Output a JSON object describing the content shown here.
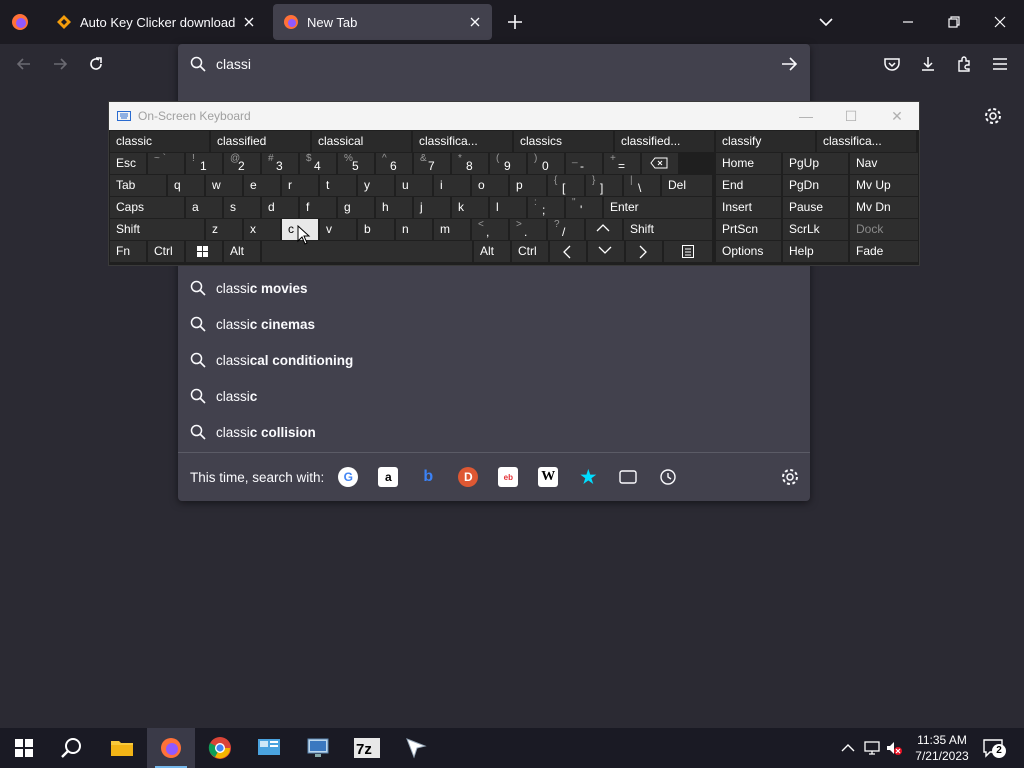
{
  "tabs": [
    {
      "title": "Auto Key Clicker download | So"
    },
    {
      "title": "New Tab"
    }
  ],
  "url": {
    "value": "classi"
  },
  "suggestions": [
    {
      "typed": "classi",
      "rest": "c movies"
    },
    {
      "typed": "classi",
      "rest": "c cinemas"
    },
    {
      "typed": "classi",
      "rest": "cal conditioning"
    },
    {
      "typed": "classi",
      "rest": "c"
    },
    {
      "typed": "classi",
      "rest": "c collision"
    }
  ],
  "oneoff": {
    "label": "This time, search with:"
  },
  "osk": {
    "title": "On-Screen Keyboard",
    "predictions": [
      "classic",
      "classified",
      "classical",
      "classifica...",
      "classics",
      "classified...",
      "classify",
      "classifica..."
    ],
    "keys": {
      "esc": "Esc",
      "tab": "Tab",
      "caps": "Caps",
      "shift": "Shift",
      "fn": "Fn",
      "ctrl": "Ctrl",
      "alt": "Alt",
      "del": "Del",
      "enter": "Enter",
      "shift_r": "Shift",
      "alt_r": "Alt",
      "ctrl_r": "Ctrl",
      "row1": [
        [
          "~ `",
          ""
        ],
        [
          "!",
          "1"
        ],
        [
          "@",
          "2"
        ],
        [
          "#",
          "3"
        ],
        [
          "$",
          "4"
        ],
        [
          "%",
          "5"
        ],
        [
          "^",
          "6"
        ],
        [
          "&",
          "7"
        ],
        [
          "*",
          "8"
        ],
        [
          "(",
          "9"
        ],
        [
          ")",
          "0"
        ],
        [
          "_",
          "-"
        ],
        [
          "+",
          "="
        ]
      ],
      "row2": [
        "q",
        "w",
        "e",
        "r",
        "t",
        "y",
        "u",
        "i",
        "o",
        "p"
      ],
      "row2b": [
        [
          "{",
          "["
        ],
        [
          "}",
          "]"
        ],
        [
          "|",
          "\\"
        ]
      ],
      "row3": [
        "a",
        "s",
        "d",
        "f",
        "g",
        "h",
        "j",
        "k",
        "l"
      ],
      "row3b": [
        [
          ":",
          ";"
        ],
        [
          "\"",
          "'"
        ]
      ],
      "row4": [
        "z",
        "x",
        "c",
        "v",
        "b",
        "n",
        "m"
      ],
      "row4b": [
        [
          "<",
          ","
        ],
        [
          ">",
          "."
        ],
        [
          "?",
          "/"
        ]
      ],
      "nav": [
        [
          "Home",
          "PgUp",
          "Nav"
        ],
        [
          "End",
          "PgDn",
          "Mv Up"
        ],
        [
          "Insert",
          "Pause",
          "Mv Dn"
        ],
        [
          "PrtScn",
          "ScrLk",
          "Dock"
        ],
        [
          "Options",
          "Help",
          "Fade"
        ]
      ]
    }
  },
  "clock": {
    "time": "11:35 AM",
    "date": "7/21/2023"
  },
  "notifications": {
    "count": "2"
  }
}
